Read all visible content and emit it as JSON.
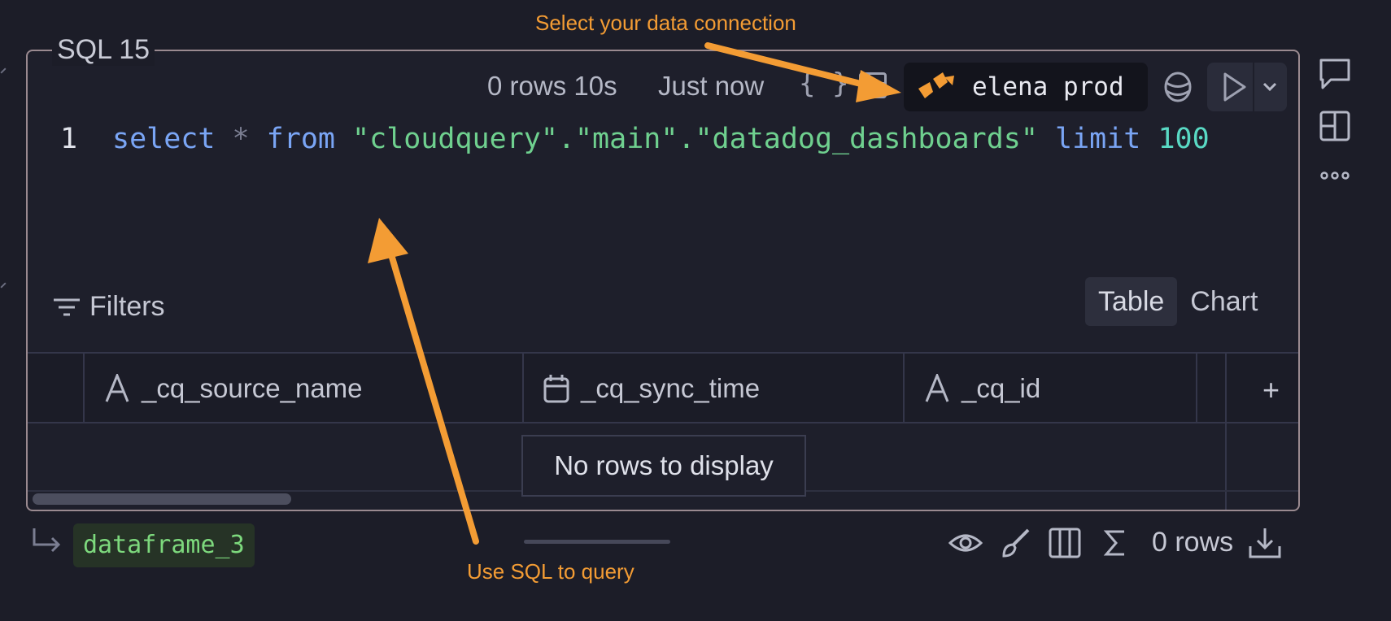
{
  "cell": {
    "title": "SQL 15",
    "row_count": "0 rows 10s",
    "last_run": "Just now",
    "connection_name": "elena prod"
  },
  "editor": {
    "line_number": "1",
    "tokens": {
      "select": "select",
      "star": "*",
      "from": "from",
      "table_ref": "\"cloudquery\".\"main\".\"datadog_dashboards\"",
      "limit": "limit",
      "limit_value": "100"
    }
  },
  "results": {
    "filters_label": "Filters",
    "view_tabs": [
      "Table",
      "Chart"
    ],
    "active_view": "Table",
    "columns": [
      {
        "name": "_cq_source_name",
        "type_icon": "text-type-icon"
      },
      {
        "name": "_cq_sync_time",
        "type_icon": "calendar-icon"
      },
      {
        "name": "_cq_id",
        "type_icon": "text-type-icon"
      }
    ],
    "add_column": "+",
    "empty_message": "No rows to display"
  },
  "footer": {
    "dataframe_name": "dataframe_3",
    "row_count": "0 rows"
  },
  "annotations": {
    "connection_hint": "Select your data connection",
    "sql_hint": "Use SQL to query"
  },
  "colors": {
    "background": "#1c1d28",
    "keyword": "#7aa5f5",
    "string": "#6fd08f",
    "number": "#59d9c4",
    "annotation": "#f39c34",
    "dataframe": "#7dd97d"
  }
}
